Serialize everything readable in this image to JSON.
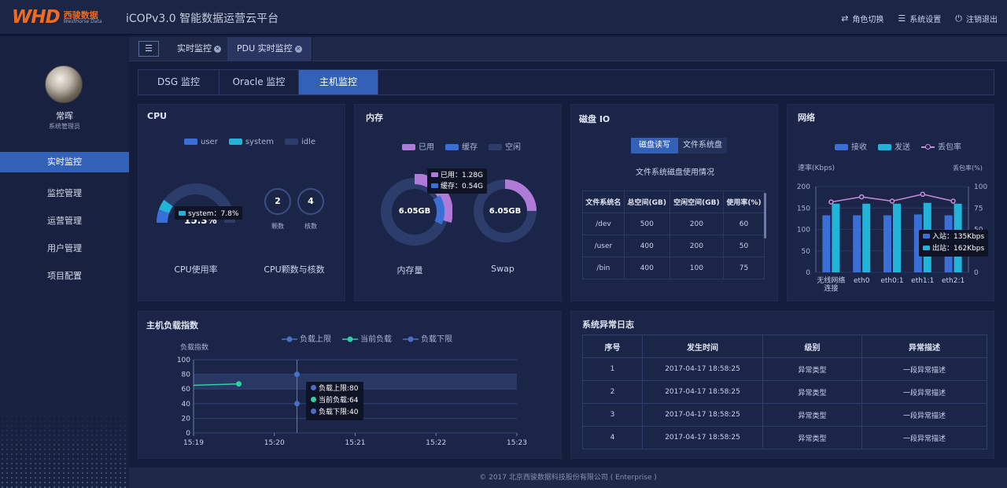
{
  "header": {
    "logo_mark": "WHD",
    "logo_cn": "西骏数据",
    "logo_en": "WestHorse Data",
    "app_title": "iCOPv3.0 智能数据运营云平台",
    "actions": [
      {
        "label": "角色切换",
        "icon": "swap-icon"
      },
      {
        "label": "系统设置",
        "icon": "settings-icon"
      },
      {
        "label": "注销退出",
        "icon": "power-icon"
      }
    ]
  },
  "sidebar": {
    "user_name": "常晖",
    "user_role": "系统管理员",
    "items": [
      {
        "label": "实时监控",
        "active": true
      },
      {
        "label": "监控管理"
      },
      {
        "label": "运营管理"
      },
      {
        "label": "用户管理"
      },
      {
        "label": "项目配置"
      }
    ]
  },
  "tabs": [
    {
      "label": "实时监控"
    },
    {
      "label": "PDU 实时监控"
    }
  ],
  "subtabs": [
    {
      "label": "DSG 监控"
    },
    {
      "label": "Oracle 监控"
    },
    {
      "label": "主机监控",
      "active": true
    }
  ],
  "cpu": {
    "title": "CPU",
    "legend": [
      "user",
      "system",
      "idle"
    ],
    "usage_value": "15.3%",
    "usage_caption": "CPU使用率",
    "tooltip": "system：7.8%",
    "sockets": "2",
    "sockets_label": "颗数",
    "cores": "4",
    "cores_label": "核数",
    "count_caption": "CPU颗数与核数",
    "colors": {
      "user": "#3a6fd8",
      "system": "#22b3d8",
      "idle": "#2d3d6b"
    }
  },
  "memory": {
    "title": "内存",
    "legend": [
      "已用",
      "缓存",
      "空闲"
    ],
    "mem_center": "6.05GB",
    "mem_caption": "内存量",
    "swap_center": "6.05GB",
    "swap_caption": "Swap",
    "tooltip_used": "已用：1.28G",
    "tooltip_cache": "缓存：0.54G",
    "colors": {
      "used": "#b07ad8",
      "cache": "#3a6fd8",
      "free": "#2d3d6b"
    }
  },
  "disk": {
    "title": "磁盘 IO",
    "tabs": [
      "磁盘读写",
      "文件系统盘"
    ],
    "subtitle": "文件系统磁盘使用情况",
    "columns": [
      "文件系统名",
      "总空间(GB)",
      "空闲空间(GB)",
      "使用率(%)"
    ],
    "rows": [
      [
        "/dev",
        "500",
        "200",
        "60"
      ],
      [
        "/user",
        "400",
        "200",
        "50"
      ],
      [
        "/bin",
        "400",
        "100",
        "75"
      ]
    ]
  },
  "network": {
    "title": "网络",
    "legend": [
      "接收",
      "发送",
      "丢包率"
    ],
    "tooltip_in": "入站：135Kbps",
    "tooltip_out": "出站：162Kbps"
  },
  "load": {
    "title": "主机负载指数",
    "legend": [
      "负载上限",
      "当前负载",
      "负载下限"
    ],
    "tooltip": [
      "负载上限:80",
      "当前负载:64",
      "负载下限:40"
    ]
  },
  "log": {
    "title": "系统异常日志",
    "columns": [
      "序号",
      "发生时间",
      "级别",
      "异常描述"
    ],
    "rows": [
      [
        "1",
        "2017-04-17 18:58:25",
        "异常类型",
        "一段异常描述"
      ],
      [
        "2",
        "2017-04-17 18:58:25",
        "异常类型",
        "一段异常描述"
      ],
      [
        "3",
        "2017-04-17 18:58:25",
        "异常类型",
        "一段异常描述"
      ],
      [
        "4",
        "2017-04-17 18:58:25",
        "异常类型",
        "一段异常描述"
      ]
    ]
  },
  "footer": {
    "text": "© 2017 北京西骏数据科技股份有限公司 ( Enterprise )"
  },
  "chart_data": [
    {
      "type": "bar",
      "ylabel": "速率(Kbps)",
      "y2label": "丢包率(%)",
      "categories": [
        "无线网络连接",
        "eth0",
        "eth0:1",
        "eth1:1",
        "eth2:1"
      ],
      "ylim": [
        0,
        200
      ],
      "y2lim": [
        0,
        100
      ],
      "series": [
        {
          "name": "接收",
          "values": [
            133,
            133,
            133,
            135,
            133
          ],
          "color": "#3a6fd8"
        },
        {
          "name": "发送",
          "values": [
            160,
            160,
            160,
            162,
            160
          ],
          "color": "#22b3d8"
        },
        {
          "name": "丢包率",
          "type": "line",
          "axis": "right",
          "values": [
            82,
            88,
            83,
            91,
            83
          ],
          "color": "#c98ae0"
        }
      ],
      "yticks": [
        0,
        50,
        100,
        150,
        200
      ],
      "y2ticks": [
        0,
        25,
        50,
        75,
        100
      ]
    },
    {
      "type": "line",
      "ylabel": "负载指数",
      "x": [
        "15:19",
        "15:20",
        "15:21",
        "15:22",
        "15:23"
      ],
      "ylim": [
        0,
        100
      ],
      "yticks": [
        0,
        20,
        40,
        60,
        80,
        100
      ],
      "series": [
        {
          "name": "负载上限",
          "values": [
            80,
            80,
            80,
            80,
            80
          ],
          "color": "#4a6fc8"
        },
        {
          "name": "当前负载",
          "points": [
            [
              0,
              65
            ],
            [
              0.56,
              67
            ]
          ],
          "color": "#2ed1a2"
        },
        {
          "name": "负载下限",
          "values": [
            40,
            40,
            40,
            40,
            40
          ],
          "color": "#4a6fc8"
        }
      ],
      "hover_x": 1.28
    }
  ]
}
